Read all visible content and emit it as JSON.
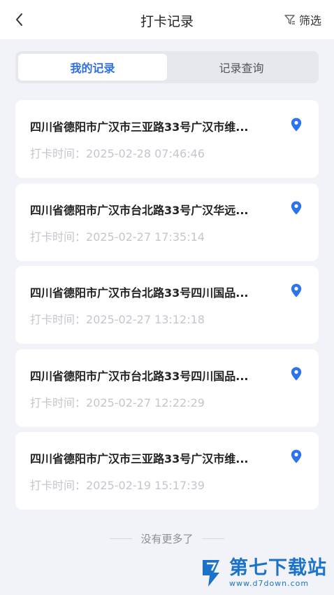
{
  "header": {
    "title": "打卡记录",
    "filter_label": "筛选"
  },
  "tabs": [
    {
      "label": "我的记录",
      "active": true
    },
    {
      "label": "记录查询",
      "active": false
    }
  ],
  "records": [
    {
      "address": "四川省德阳市广汉市三亚路33号广汉市维...",
      "time_prefix": "打卡时间：",
      "time": "2025-02-28 07:46:46"
    },
    {
      "address": "四川省德阳市广汉市台北路33号广汉华远...",
      "time_prefix": "打卡时间：",
      "time": "2025-02-27 17:35:14"
    },
    {
      "address": "四川省德阳市广汉市台北路33号四川国品...",
      "time_prefix": "打卡时间：",
      "time": "2025-02-27 13:12:18"
    },
    {
      "address": "四川省德阳市广汉市台北路33号四川国品...",
      "time_prefix": "打卡时间：",
      "time": "2025-02-27 12:22:29"
    },
    {
      "address": "四川省德阳市广汉市三亚路33号广汉市维...",
      "time_prefix": "打卡时间：",
      "time": "2025-02-19 15:17:39"
    }
  ],
  "footer": {
    "text": "没有更多了"
  },
  "watermark": {
    "title": "第七下载站",
    "url": "www.d7down.com"
  },
  "colors": {
    "accent": "#2f6fe4",
    "pin": "#2d74ea",
    "background": "#f2f3f8",
    "muted_text": "#c3c6cd"
  },
  "icons": {
    "back": "chevron-left-icon",
    "filter": "filter-icon",
    "location": "location-pin-icon"
  }
}
